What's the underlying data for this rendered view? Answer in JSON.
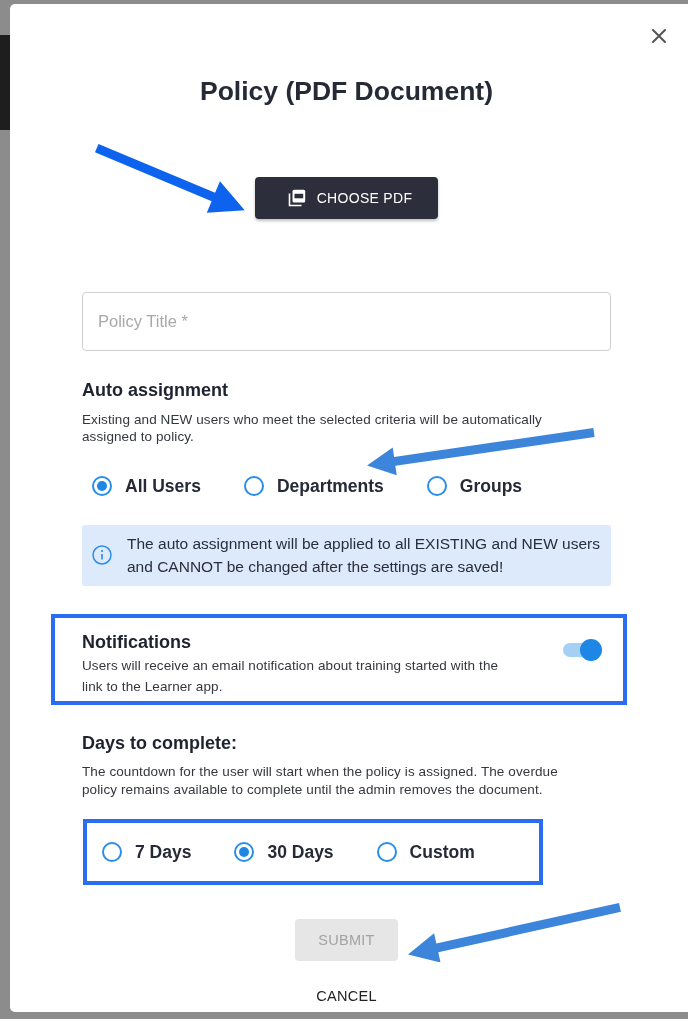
{
  "dialog": {
    "title": "Policy (PDF Document)"
  },
  "upload_button": {
    "label": "CHOOSE PDF",
    "arrow": true
  },
  "title_field": {
    "placeholder": "Policy Title *"
  },
  "auto_assignment": {
    "heading": "Auto assignment",
    "description": "Existing and NEW users who meet the selected criteria will be automatically assigned to policy.",
    "options": [
      {
        "label": "All Users",
        "selected": true,
        "arrow": false
      },
      {
        "label": "Departments",
        "selected": false,
        "arrow": true
      },
      {
        "label": "Groups",
        "selected": false,
        "arrow": false
      }
    ],
    "notice": "The auto assignment will be applied to all EXISTING and NEW users and CANNOT be changed after the settings are saved!"
  },
  "notifications": {
    "heading": "Notifications",
    "description": "Users will receive an email notification about training started with the link to the Learner app.",
    "on": true,
    "highlighted": true
  },
  "days_to_complete": {
    "heading": "Days to complete:",
    "description": "The countdown for the user will start when the policy is assigned. The overdue policy remains available to complete until the admin removes the document.",
    "options": [
      {
        "label": "7 Days",
        "selected": false
      },
      {
        "label": "30 Days",
        "selected": true
      },
      {
        "label": "Custom",
        "selected": false
      }
    ],
    "highlighted": true
  },
  "actions": [
    {
      "label": "SUBMIT",
      "kind": "button",
      "disabled": true,
      "arrow": true
    },
    {
      "label": "CANCEL",
      "kind": "link",
      "disabled": false,
      "arrow": false
    }
  ]
}
